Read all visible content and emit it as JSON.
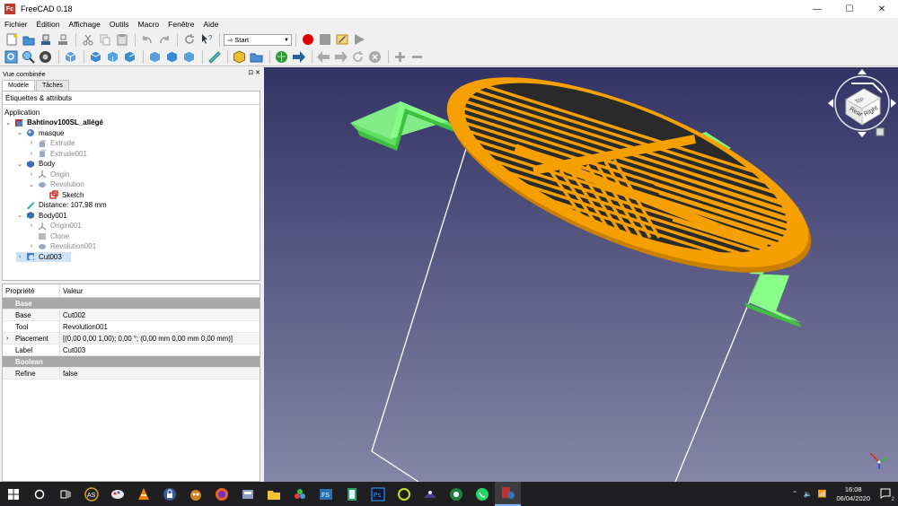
{
  "window": {
    "title": "FreeCAD 0.18",
    "app_icon_text": "Fc",
    "minimize": "—",
    "maximize": "☐",
    "close": "✕"
  },
  "menu": [
    {
      "label": "Fichier"
    },
    {
      "label": "Édition"
    },
    {
      "label": "Affichage"
    },
    {
      "label": "Outils"
    },
    {
      "label": "Macro"
    },
    {
      "label": "Fenêtre"
    },
    {
      "label": "Aide"
    }
  ],
  "toolbar": {
    "workbench": "Start"
  },
  "combo_view": {
    "title": "Vue combinée",
    "header_buttons": "⊡ ✕",
    "tabs": [
      "Modèle",
      "Tâches"
    ],
    "tree_header": "Étiquettes & attributs",
    "section": "Application",
    "tree": [
      {
        "label": "Bahtinov100SL_allégé",
        "exp": "⌄",
        "icon": "document-icon",
        "bold": true,
        "dim": false
      },
      {
        "label": "masque",
        "exp": "⌄",
        "icon": "part-icon",
        "bold": false,
        "dim": false
      },
      {
        "label": "Extrude",
        "exp": "›",
        "icon": "extrude-icon",
        "bold": false,
        "dim": true
      },
      {
        "label": "Extrude001",
        "exp": "›",
        "icon": "extrude-icon",
        "bold": false,
        "dim": true
      },
      {
        "label": "Body",
        "exp": "⌄",
        "icon": "body-icon",
        "bold": false,
        "dim": false
      },
      {
        "label": "Origin",
        "exp": "›",
        "icon": "origin-icon",
        "bold": false,
        "dim": true
      },
      {
        "label": "Revolution",
        "exp": "⌄",
        "icon": "revolution-icon",
        "bold": false,
        "dim": true
      },
      {
        "label": "Sketch",
        "exp": "",
        "icon": "sketch-icon",
        "bold": false,
        "dim": false
      },
      {
        "label": "Distance: 107,98 mm",
        "exp": "",
        "icon": "measure-icon",
        "bold": false,
        "dim": false
      },
      {
        "label": "Body001",
        "exp": "⌄",
        "icon": "body-icon",
        "bold": false,
        "dim": false
      },
      {
        "label": "Origin001",
        "exp": "›",
        "icon": "origin-icon",
        "bold": false,
        "dim": true
      },
      {
        "label": "Clone",
        "exp": "",
        "icon": "clone-icon",
        "bold": false,
        "dim": true
      },
      {
        "label": "Revolution001",
        "exp": "›",
        "icon": "revolution-icon",
        "bold": false,
        "dim": true
      },
      {
        "label": "Cut003",
        "exp": "›",
        "icon": "cut-icon",
        "bold": false,
        "dim": false,
        "selected": true
      }
    ]
  },
  "properties": {
    "col_name": "Propriété",
    "col_value": "Valeur",
    "rows": [
      {
        "type": "group",
        "name": "Base",
        "value": ""
      },
      {
        "type": "prop",
        "name": "Base",
        "value": "Cut002",
        "exp": ""
      },
      {
        "type": "prop",
        "name": "Tool",
        "value": "Revolution001",
        "exp": ""
      },
      {
        "type": "prop",
        "name": "Placement",
        "value": "[(0,00 0,00 1,00); 0,00 °; (0,00 mm  0,00 mm  0,00 mm)]",
        "exp": "›"
      },
      {
        "type": "prop",
        "name": "Label",
        "value": "Cut003",
        "exp": ""
      },
      {
        "type": "group",
        "name": "Boolean",
        "value": ""
      },
      {
        "type": "prop",
        "name": "Refine",
        "value": "false",
        "exp": ""
      }
    ]
  },
  "navcube": {
    "face_top": "Top",
    "face_rear": "Rear",
    "face_right": "Right"
  },
  "colors": {
    "orange": "#f5a000",
    "green": "#7dff7d",
    "bg_top": "#333366",
    "bg_bottom": "#8585a6"
  },
  "taskbar": {
    "time": "16:08",
    "date": "06/04/2020",
    "notifications": "2"
  }
}
